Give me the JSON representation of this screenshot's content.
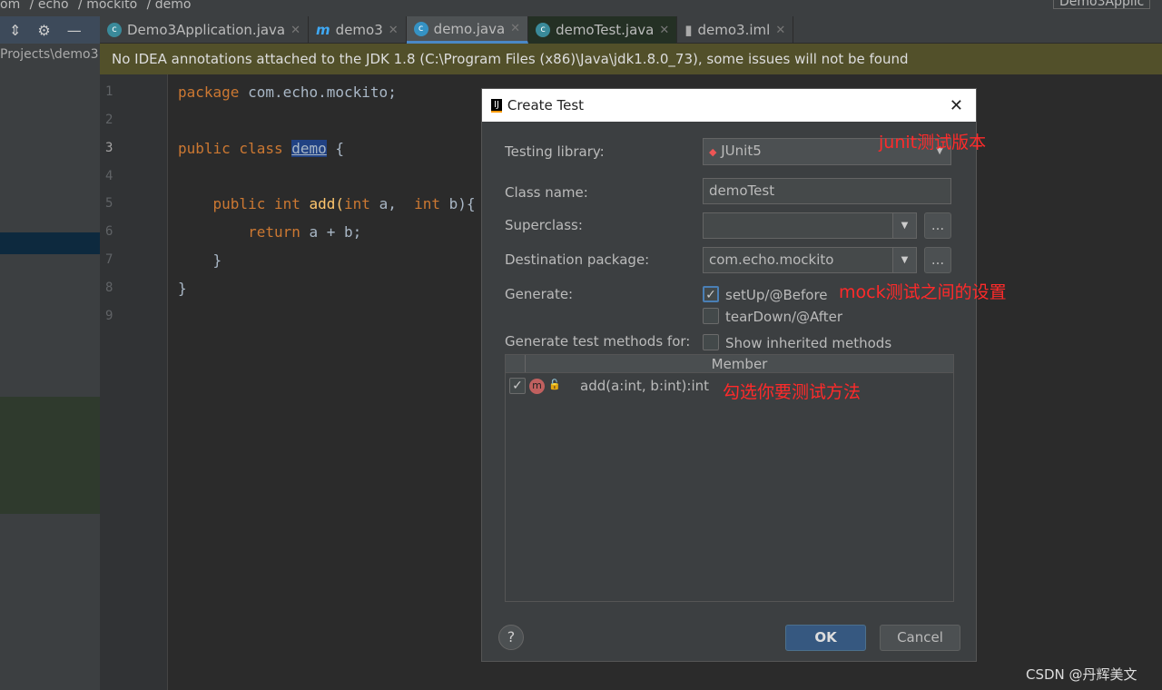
{
  "breadcrumb": [
    "om",
    "echo",
    "mockito",
    "demo"
  ],
  "left_panel": {
    "path": "Projects\\demo3"
  },
  "tabs": [
    {
      "label": "Demo3Application.java"
    },
    {
      "label": "demo3"
    },
    {
      "label": "demo.java"
    },
    {
      "label": "demoTest.java"
    },
    {
      "label": "demo3.iml"
    }
  ],
  "top_right": {
    "run_config": "Demo3Applic"
  },
  "notice": "No IDEA annotations attached to the JDK 1.8 (C:\\Program Files (x86)\\Java\\jdk1.8.0_73), some issues will not be found",
  "code": {
    "line_numbers": [
      "1",
      "2",
      "3",
      "4",
      "5",
      "6",
      "7",
      "8",
      "9"
    ],
    "l1a": "package ",
    "l1b": "com.echo.mockito;",
    "l3a": "public class ",
    "l3b": "demo",
    " l3c": " {",
    "l3c2": " {",
    "l5a": "    public int ",
    "l5b": "add(",
    "l5c": "int ",
    "l5d": "a,  ",
    "l5e": "int ",
    "l5f": "b){",
    "l6a": "        return ",
    "l6b": "a + b;",
    "l7": "    }",
    "l8": "}"
  },
  "dialog": {
    "title": "Create Test",
    "testing_library_label": "Testing library:",
    "testing_library": "JUnit5",
    "class_name_label": "Class name:",
    "class_name": "demoTest",
    "superclass_label": "Superclass:",
    "superclass": "",
    "dest_label": "Destination package:",
    "dest": "com.echo.mockito",
    "generate_label": "Generate:",
    "setup": "setUp/@Before",
    "setup_checked": true,
    "teardown": "tearDown/@After",
    "teardown_checked": false,
    "methods_label": "Generate test methods for:",
    "inherited": "Show inherited methods",
    "inherited_checked": false,
    "member_header": "Member",
    "member": "add(a:int, b:int):int",
    "member_checked": true,
    "browse": "...",
    "ok": "OK",
    "cancel": "Cancel",
    "help": "?"
  },
  "annotations": {
    "junit": "junit测试版本",
    "mock": "mock测试之间的设置",
    "select": "勾选你要测试方法"
  },
  "watermark": "CSDN @丹辉美文"
}
